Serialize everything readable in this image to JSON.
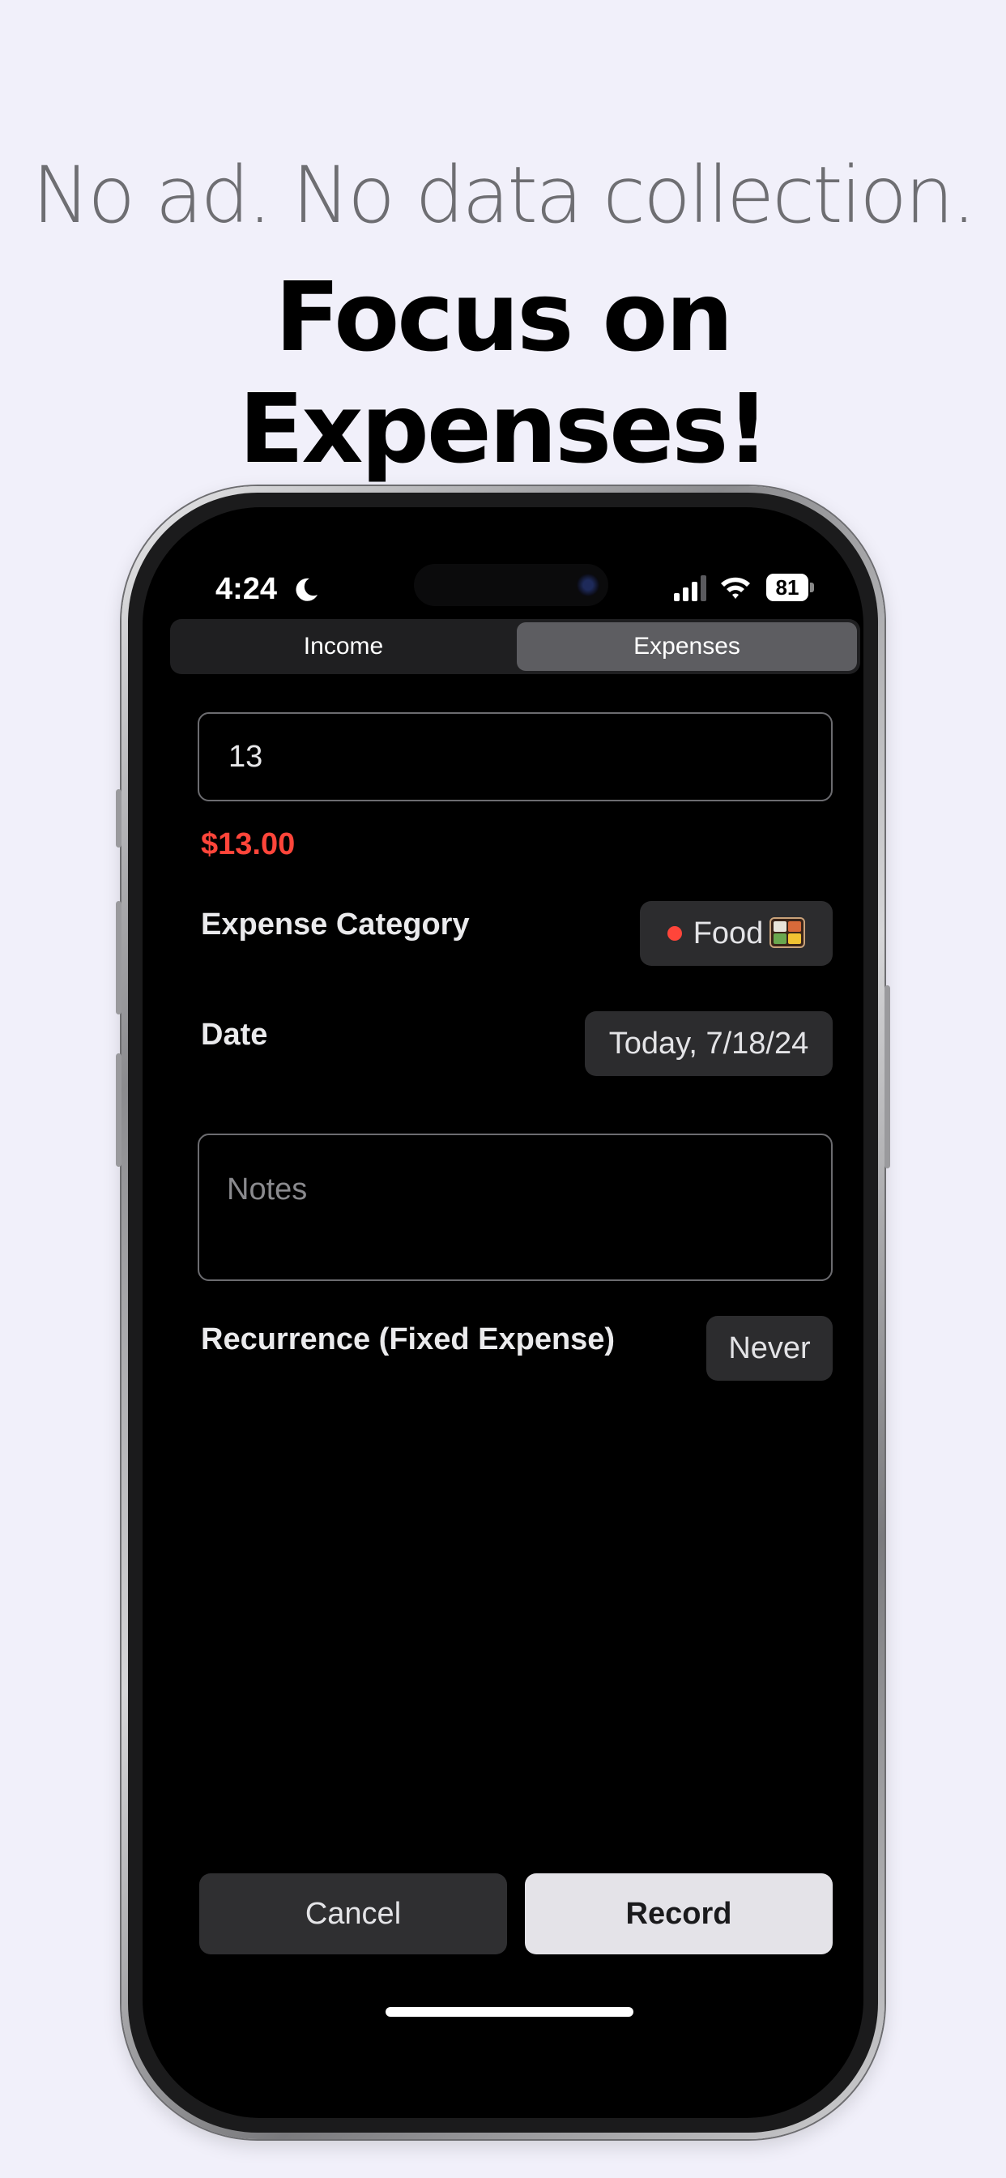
{
  "marketing": {
    "tagline": "No ad. No data collection.",
    "headline": "Focus on Expenses!"
  },
  "status_bar": {
    "time": "4:24",
    "battery": "81",
    "icons": [
      "moon-icon",
      "signal-icon",
      "wifi-icon",
      "battery-icon"
    ]
  },
  "segmented_control": {
    "tabs": [
      {
        "label": "Income",
        "selected": false
      },
      {
        "label": "Expenses",
        "selected": true
      }
    ]
  },
  "form": {
    "amount_value": "13",
    "amount_formatted": "$13.00",
    "category_label": "Expense Category",
    "category_value": "Food",
    "category_color": "#ff453a",
    "date_label": "Date",
    "date_value": "Today, 7/18/24",
    "notes_placeholder": "Notes",
    "recurrence_label": "Recurrence (Fixed Expense)",
    "recurrence_value": "Never"
  },
  "actions": {
    "cancel_label": "Cancel",
    "record_label": "Record"
  }
}
